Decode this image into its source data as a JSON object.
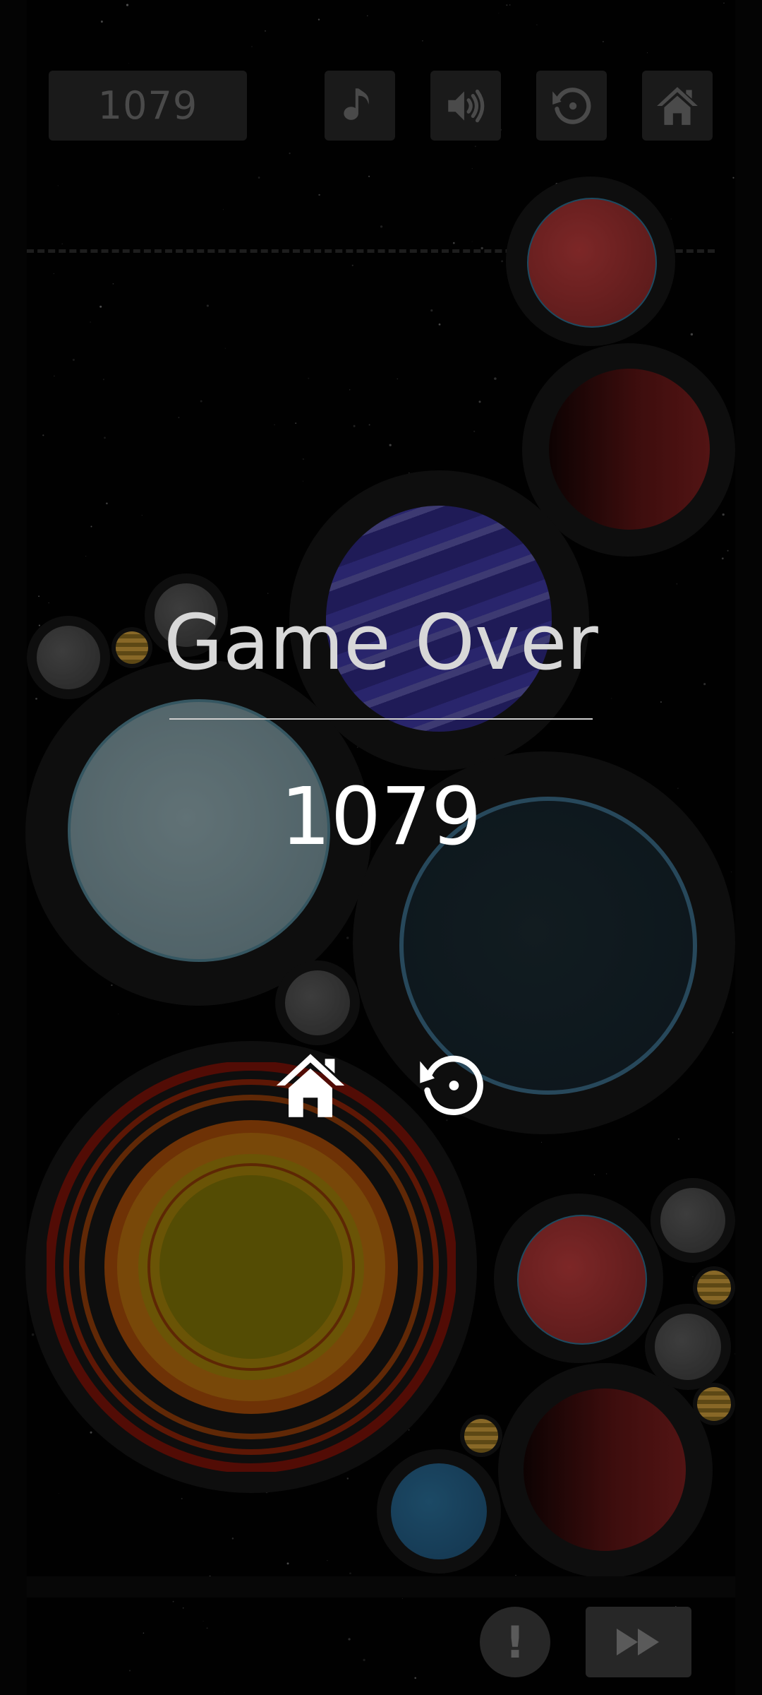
{
  "hud": {
    "score": "1079",
    "music_icon": "music-note-icon",
    "sound_icon": "speaker-icon",
    "restart_icon": "restart-icon",
    "home_icon": "home-icon"
  },
  "game_over": {
    "title": "Game Over",
    "score": "1079",
    "home_icon": "home-icon",
    "restart_icon": "restart-icon"
  },
  "bottom": {
    "alert_label": "!",
    "alert_icon": "exclamation-icon",
    "fast_forward_icon": "fast-forward-icon"
  },
  "colors": {
    "background": "#020202",
    "hud_button": "#272727",
    "hud_icon": "#6e6e6e",
    "overlay_text": "#ffffff"
  }
}
